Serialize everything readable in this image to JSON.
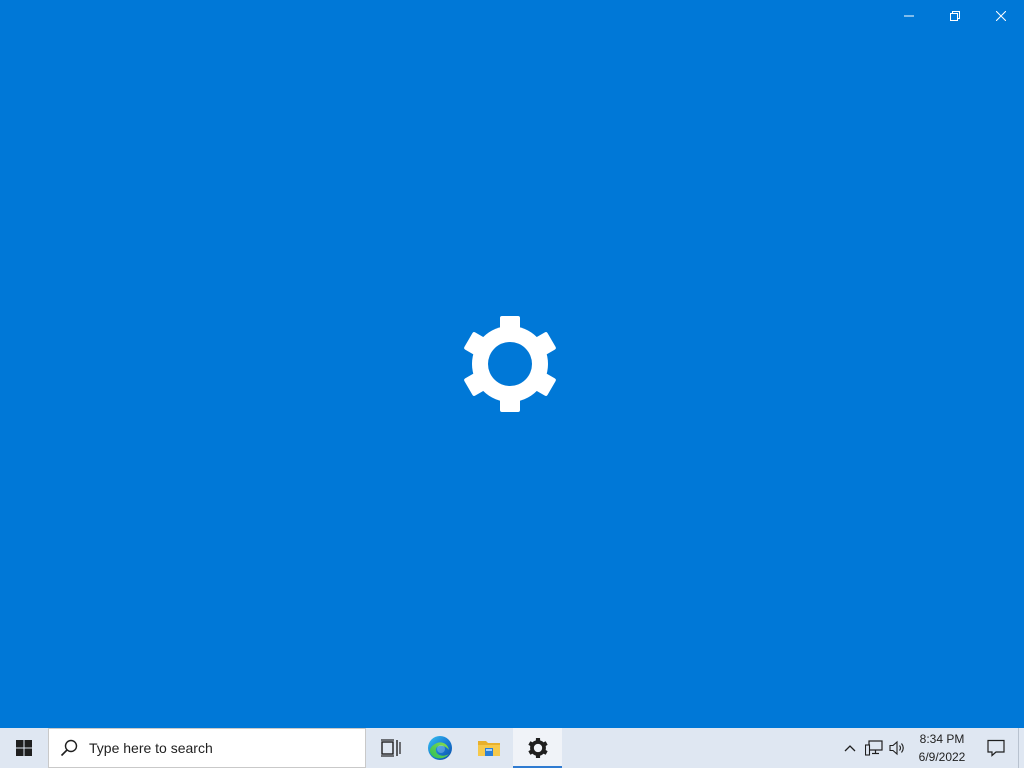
{
  "app_window": {
    "background_color": "#0078d7",
    "splash_icon": "gear-icon",
    "controls": {
      "minimize_icon": "minimize-icon",
      "restore_icon": "restore-icon",
      "close_icon": "close-icon"
    }
  },
  "taskbar": {
    "start_icon": "windows-logo-icon",
    "search": {
      "placeholder": "Type here to search",
      "icon": "search-icon"
    },
    "pinned": [
      {
        "name": "task-view",
        "icon": "task-view-icon",
        "active": false
      },
      {
        "name": "edge",
        "icon": "edge-icon",
        "active": false
      },
      {
        "name": "file-explorer",
        "icon": "folder-icon",
        "active": false
      },
      {
        "name": "settings",
        "icon": "gear-icon",
        "active": true
      }
    ],
    "tray": {
      "icons": [
        "chevron-up-icon",
        "network-icon",
        "volume-icon"
      ],
      "time": "8:34 PM",
      "date": "6/9/2022",
      "notification_icon": "notification-icon"
    },
    "background_color": "#dfe7f2",
    "active_indicator_color": "#2f7bd1"
  }
}
